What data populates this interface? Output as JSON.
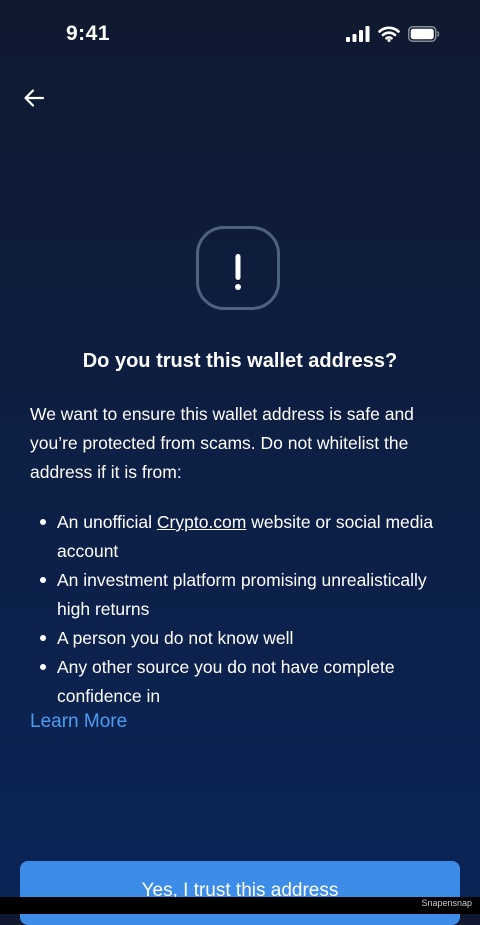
{
  "status_bar": {
    "time": "9:41",
    "icons": [
      "signal-icon",
      "wifi-icon",
      "battery-icon"
    ]
  },
  "nav": {
    "back_icon": "arrow-left-icon"
  },
  "alert": {
    "icon": "exclamation-icon"
  },
  "title": "Do you trust this wallet address?",
  "intro": "We want to ensure this wallet address is safe and you’re protected from scams. Do not whitelist the address if it is from:",
  "bullets": [
    {
      "before": "An unofficial ",
      "link": "Crypto.com",
      "after": " website or social media account"
    },
    {
      "text": "An investment platform promising unrealistically high returns"
    },
    {
      "text": "A person you do not know well"
    },
    {
      "text": "Any other source you do not have complete confidence in"
    }
  ],
  "learn_more": "Learn More",
  "primary_button": "Yes, I trust this address",
  "watermark": "Snapensnap",
  "colors": {
    "background_top": "#0f1a30",
    "background_bottom": "#0b2558",
    "accent_link": "#4f9cf2",
    "button": "#3d8de8",
    "icon_ring": "#4e6280"
  }
}
